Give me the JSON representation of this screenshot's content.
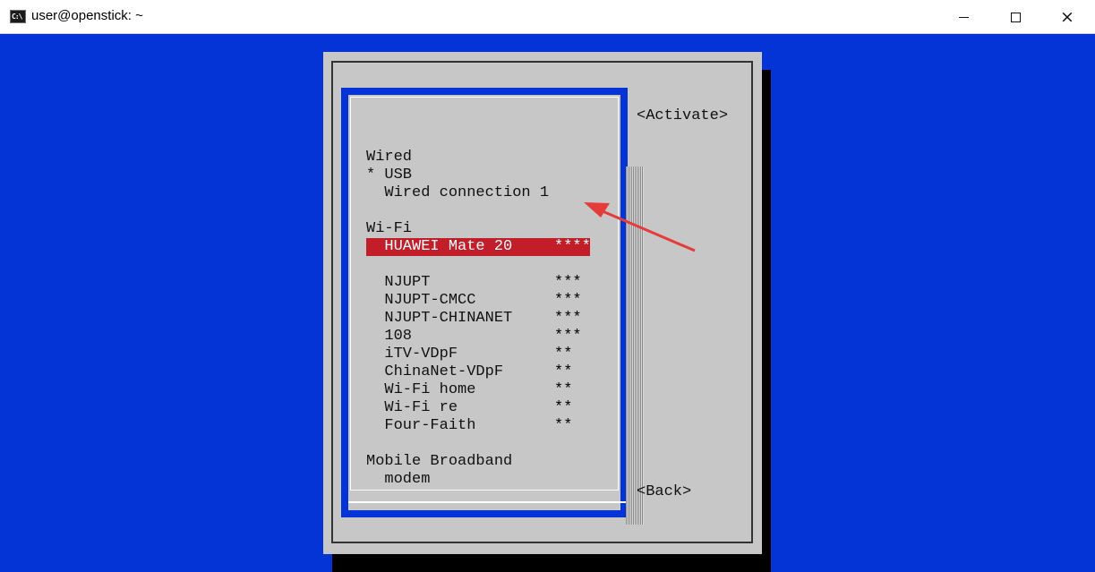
{
  "window": {
    "title": "user@openstick: ~",
    "icon": "terminal-icon"
  },
  "controls": {
    "minimize": "minimize",
    "maximize": "maximize",
    "close": "×"
  },
  "sections": [
    {
      "name": "Wired",
      "items": [
        {
          "label": "* USB",
          "strength": ""
        },
        {
          "label": "  Wired connection 1",
          "strength": ""
        }
      ]
    },
    {
      "name": "Wi-Fi",
      "items": [
        {
          "label": "  HUAWEI Mate 20",
          "strength": "****"
        },
        {
          "label": "",
          "strength": ""
        },
        {
          "label": "  NJUPT",
          "strength": "***"
        },
        {
          "label": "  NJUPT-CMCC",
          "strength": "***"
        },
        {
          "label": "  NJUPT-CHINANET",
          "strength": "***"
        },
        {
          "label": "  108",
          "strength": "***"
        },
        {
          "label": "  iTV-VDpF",
          "strength": "**"
        },
        {
          "label": "  ChinaNet-VDpF",
          "strength": "**"
        },
        {
          "label": "  Wi-Fi home",
          "strength": "**"
        },
        {
          "label": "  Wi-Fi re",
          "strength": "**"
        },
        {
          "label": "  Four-Faith",
          "strength": "**"
        }
      ]
    },
    {
      "name": "Mobile Broadband",
      "items": [
        {
          "label": "  modem",
          "strength": ""
        }
      ]
    }
  ],
  "buttons": {
    "activate": "<Activate>",
    "back": "<Back>"
  },
  "colors": {
    "background": "#0433d6",
    "dialog": "#c7c7c7",
    "selected": "#c21e2a",
    "arrow": "#e63b3b"
  }
}
